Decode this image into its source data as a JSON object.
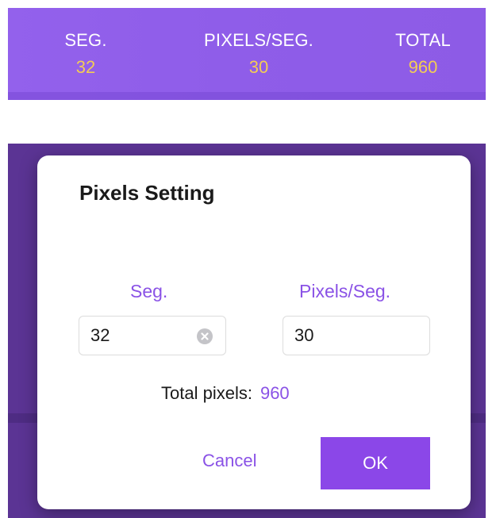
{
  "stats": {
    "seg_label": "SEG.",
    "seg_value": "32",
    "pixels_per_seg_label": "PIXELS/SEG.",
    "pixels_per_seg_value": "30",
    "total_label": "TOTAL",
    "total_value": "960"
  },
  "dialog": {
    "title": "Pixels Setting",
    "seg_label": "Seg.",
    "seg_value": "32",
    "pixels_per_seg_label": "Pixels/Seg.",
    "pixels_per_seg_value": "30",
    "total_label": "Total pixels:",
    "total_value": "960",
    "cancel_label": "Cancel",
    "ok_label": "OK"
  },
  "icons": {
    "clear": "clear-circle-x-icon"
  },
  "colors": {
    "bar_purple": "#9361ec",
    "value_yellow": "#f3cc55",
    "accent_purple": "#8a52e6",
    "ok_button": "#8b47e8",
    "backdrop": "#5b3494"
  }
}
